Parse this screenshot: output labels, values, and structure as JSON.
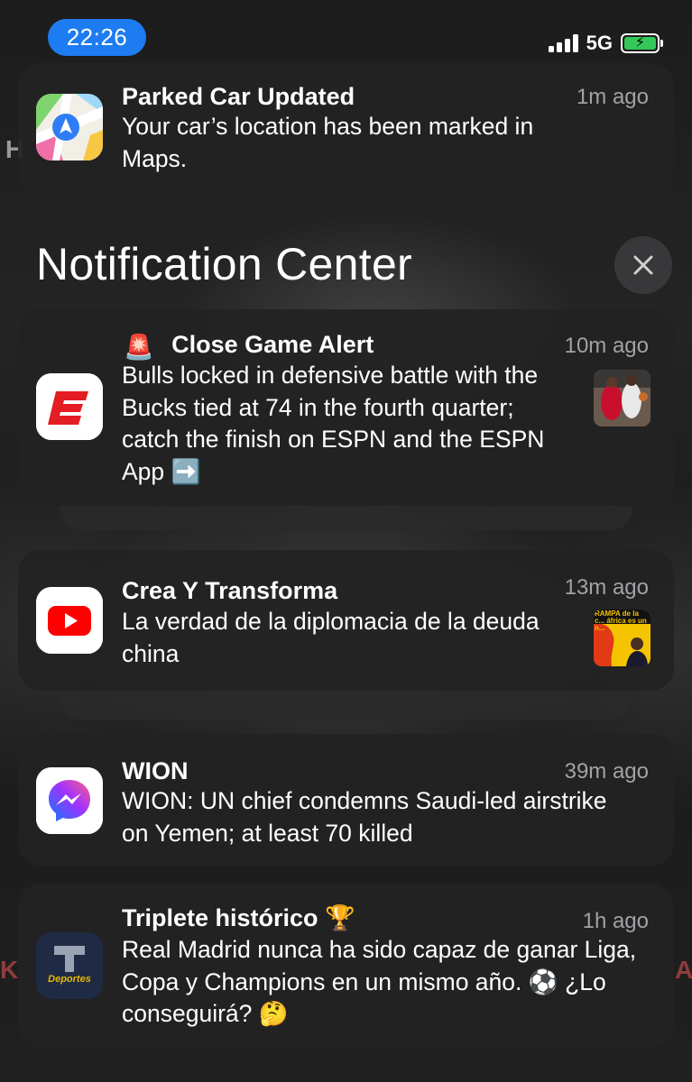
{
  "status_bar": {
    "time": "22:26",
    "network": "5G",
    "battery_charging": true,
    "signal_bars": 4,
    "colors": {
      "time_pill": "#1e7cf2",
      "battery": "#34c759"
    }
  },
  "banner": {
    "app_icon": "maps-app-icon",
    "title": "Parked Car Updated",
    "time": "1m ago",
    "body": "Your car’s location has been marked in Maps."
  },
  "notification_center": {
    "title": "Notification Center",
    "close_icon": "close-icon"
  },
  "notifications": [
    {
      "app_icon": "espn-app-icon",
      "title_emoji": "🚨",
      "title": "Close Game Alert",
      "time": "10m ago",
      "body": "Bulls locked in defensive battle with the Bucks tied at 74 in the fourth quarter; catch the finish on ESPN and the ESPN App ➡️",
      "thumbnail": "basketball-thumbnail",
      "stacked": true
    },
    {
      "app_icon": "youtube-app-icon",
      "title": "Crea Y Transforma",
      "time": "13m ago",
      "body": "La verdad de la diplomacia de la deuda china",
      "thumbnail": "video-thumbnail",
      "thumbnail_text": "RAMPA de la c... áfrica es un n...",
      "stacked": true
    },
    {
      "app_icon": "messenger-app-icon",
      "title": "WION",
      "time": "39m ago",
      "body": "WION: UN chief condemns Saudi-led airstrike on Yemen; at least 70 killed",
      "stacked": false
    },
    {
      "app_icon": "telemundo-deportes-app-icon",
      "app_icon_text": "Deportes",
      "title": "Triplete histórico 🏆",
      "time": "1h ago",
      "body": "Real Madrid nunca ha sido capaz de ganar Liga, Copa y Champions en un mismo año. ⚽️ ¿Lo conseguirá? 🤔",
      "stacked": false
    }
  ]
}
